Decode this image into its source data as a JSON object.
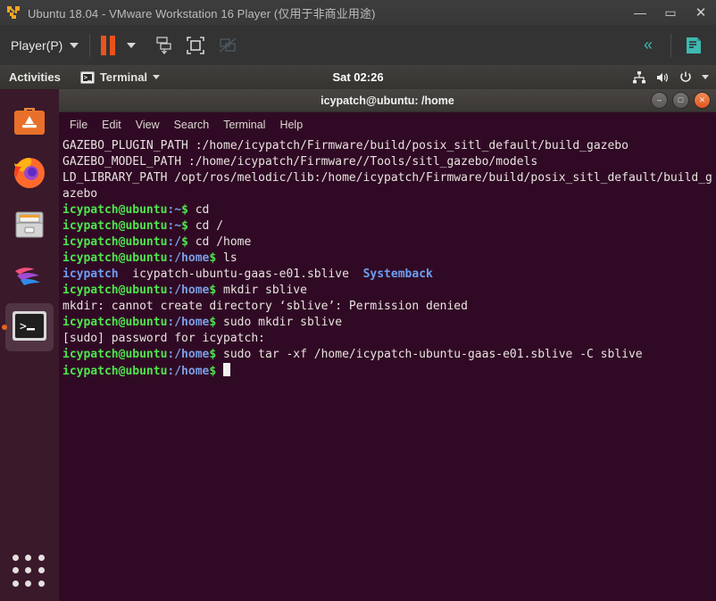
{
  "vmware": {
    "title": "Ubuntu 18.04 - VMware Workstation 16 Player (仅用于非商业用途)",
    "app_icon": "vmware-logo-icon",
    "window_buttons": {
      "minimize": "—",
      "maximize": "▭",
      "close": "✕"
    },
    "toolbar": {
      "player_menu": "Player(P)",
      "player_caret": "chevron-down-icon",
      "pause_button": "pause-icon",
      "pause_caret": "chevron-down-icon",
      "send_cad_button": "send-ctrl-alt-del-icon",
      "fullscreen_button": "enter-fullscreen-icon",
      "unity_button": "unity-mode-icon",
      "collapse_button": "«",
      "notes_button": "notes-icon"
    }
  },
  "ubuntu": {
    "topbar": {
      "activities": "Activities",
      "app_menu_label": "Terminal",
      "app_menu_icon": "terminal-icon",
      "app_menu_caret": "chevron-down-icon",
      "clock": "Sat 02:26",
      "tray": [
        "network-icon",
        "volume-icon",
        "power-icon",
        "chevron-down-icon"
      ]
    },
    "dock": {
      "items": [
        {
          "name": "ubuntu-software",
          "icon": "ubuntu-software-icon",
          "active": false
        },
        {
          "name": "firefox",
          "icon": "firefox-icon",
          "active": false
        },
        {
          "name": "files",
          "icon": "files-icon",
          "active": false
        },
        {
          "name": "rhythmbox",
          "icon": "rhythmbox-icon",
          "active": false
        },
        {
          "name": "terminal",
          "icon": "terminal-icon",
          "active": true
        }
      ],
      "show_apps": "show-applications-icon"
    }
  },
  "terminal": {
    "title": "icypatch@ubuntu: /home",
    "menu": [
      "File",
      "Edit",
      "View",
      "Search",
      "Terminal",
      "Help"
    ],
    "window_buttons": {
      "minimize": "–",
      "maximize": "□",
      "close": "✕"
    },
    "colors": {
      "background": "#300a24",
      "foreground": "#e8e3e0",
      "prompt_user": "#4ee44e",
      "prompt_path": "#7a9ee8",
      "dir": "#6c9ef2",
      "close_button": "#e2551f"
    },
    "lines": [
      {
        "type": "plain",
        "text": "GAZEBO_PLUGIN_PATH :/home/icypatch/Firmware/build/posix_sitl_default/build_gazebo"
      },
      {
        "type": "plain",
        "text": "GAZEBO_MODEL_PATH :/home/icypatch/Firmware//Tools/sitl_gazebo/models"
      },
      {
        "type": "plain",
        "text": "LD_LIBRARY_PATH /opt/ros/melodic/lib:/home/icypatch/Firmware/build/posix_sitl_default/build_gazebo"
      },
      {
        "type": "prompt",
        "user": "icypatch@ubuntu",
        "path": ":~",
        "sigil": "$ ",
        "command": "cd"
      },
      {
        "type": "prompt",
        "user": "icypatch@ubuntu",
        "path": ":~",
        "sigil": "$ ",
        "command": "cd /"
      },
      {
        "type": "prompt",
        "user": "icypatch@ubuntu",
        "path": ":/",
        "sigil": "$ ",
        "command": "cd /home"
      },
      {
        "type": "prompt",
        "user": "icypatch@ubuntu",
        "path": ":/home",
        "sigil": "$ ",
        "command": "ls"
      },
      {
        "type": "ls",
        "entries": [
          {
            "text": "icypatch",
            "color": "dir"
          },
          {
            "text": "icypatch-ubuntu-gaas-e01.sblive",
            "color": "file"
          },
          {
            "text": "Systemback",
            "color": "dir"
          }
        ]
      },
      {
        "type": "prompt",
        "user": "icypatch@ubuntu",
        "path": ":/home",
        "sigil": "$ ",
        "command": "mkdir sblive"
      },
      {
        "type": "plain",
        "text": "mkdir: cannot create directory ‘sblive’: Permission denied"
      },
      {
        "type": "prompt",
        "user": "icypatch@ubuntu",
        "path": ":/home",
        "sigil": "$ ",
        "command": "sudo mkdir sblive"
      },
      {
        "type": "plain",
        "text": "[sudo] password for icypatch:"
      },
      {
        "type": "prompt",
        "user": "icypatch@ubuntu",
        "path": ":/home",
        "sigil": "$ ",
        "command": "sudo tar -xf /home/icypatch-ubuntu-gaas-e01.sblive -C sblive"
      },
      {
        "type": "prompt-cursor",
        "user": "icypatch@ubuntu",
        "path": ":/home",
        "sigil": "$ ",
        "command": ""
      }
    ]
  }
}
